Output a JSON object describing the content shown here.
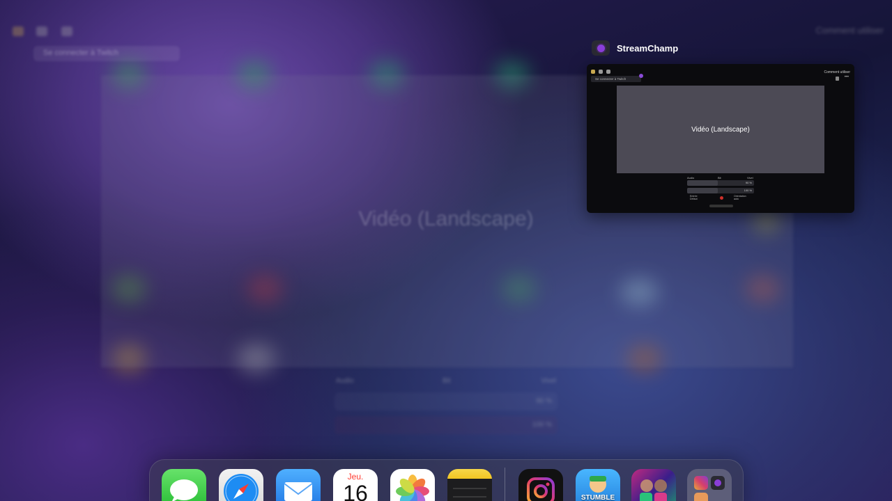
{
  "background": {
    "video_title_ghost": "Vidéo (Landscape)"
  },
  "switcher": {
    "app_name": "StreamChamp",
    "preview": {
      "connect_text": "Se connecter à Twitch",
      "how_to_text": "Comment utiliser",
      "video_label": "Vidéo (Landscape)",
      "audio_header": [
        "Audio",
        "Bit",
        "Vivel"
      ],
      "mic_value": "90 %",
      "media_value": "100 %",
      "left_caption_title": "Entrée",
      "left_caption_value": "Défaut",
      "right_caption_title": "Orientation",
      "right_caption_value": "auto"
    }
  },
  "dock": {
    "calendar_day": "Jeu.",
    "calendar_date": "16",
    "stumble_text": "STUMBLE GUYS",
    "apps": [
      "Messages",
      "Safari",
      "Mail",
      "Calendrier",
      "Photos",
      "Notes",
      "Instagram",
      "Stumble Guys",
      "eFootball",
      "Folder"
    ]
  },
  "colors": {
    "accent": "#8a3ed8",
    "card_bg": "#0b0b0e",
    "video_bg": "#4c4a55"
  }
}
